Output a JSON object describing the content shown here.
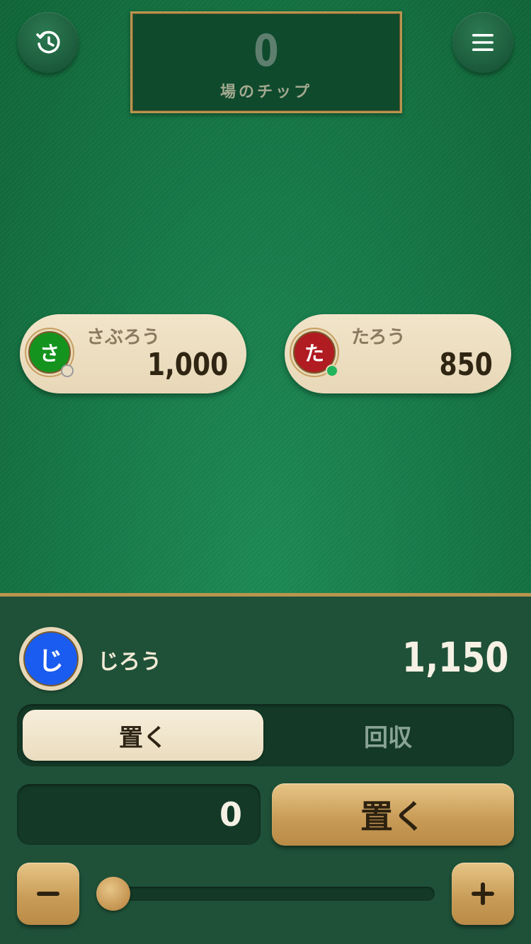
{
  "top_bar": {
    "history_button": "history-icon",
    "menu_button": "menu-icon"
  },
  "pot": {
    "value": "0",
    "label": "場のチップ"
  },
  "opponents": [
    {
      "initial": "さ",
      "name": "さぶろう",
      "chips": "1,000",
      "color": "#14941f",
      "status": "inactive"
    },
    {
      "initial": "た",
      "name": "たろう",
      "chips": "850",
      "color": "#b01c22",
      "status": "active"
    }
  ],
  "self": {
    "initial": "じ",
    "name": "じろう",
    "chips": "1,150",
    "color": "#1a5cf0"
  },
  "mode_toggle": {
    "place_label": "置く",
    "collect_label": "回収",
    "selected": "place"
  },
  "bet": {
    "amount": "0",
    "action_label": "置く",
    "slider_fraction": 0
  },
  "colors": {
    "felt": "#177a49",
    "gold": "#b8954f",
    "panel": "#1f5138"
  }
}
